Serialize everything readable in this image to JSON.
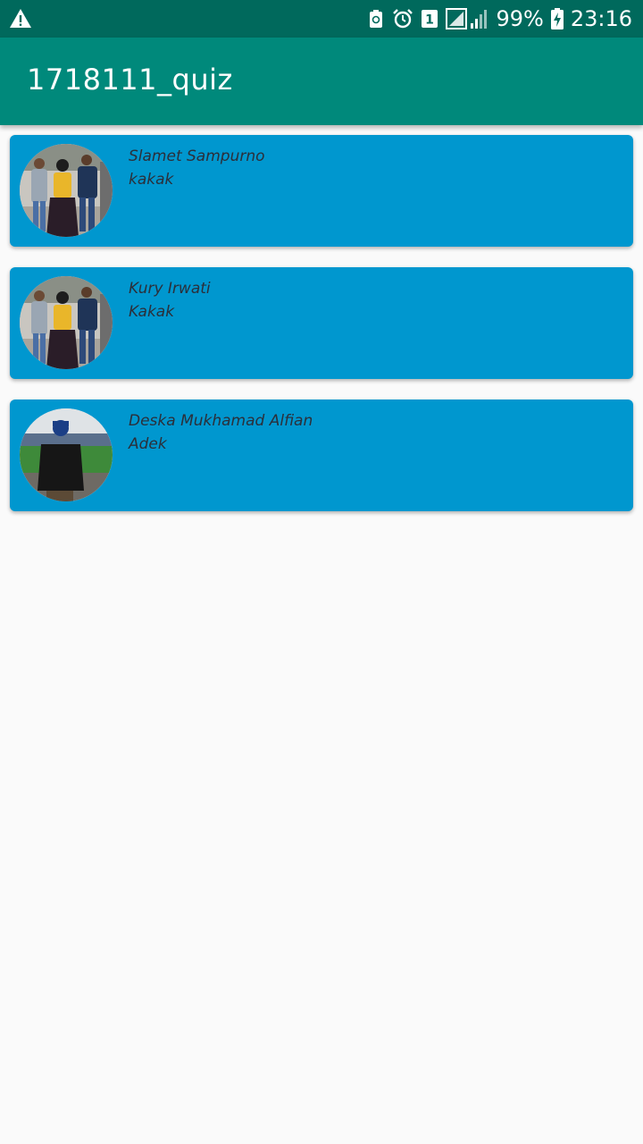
{
  "status_bar": {
    "battery_percent": "99%",
    "time": "23:16",
    "sim_number": "1",
    "icons": [
      "warning-icon",
      "battery-saver-icon",
      "alarm-icon",
      "sim-icon",
      "signal-icon",
      "battery-icon"
    ]
  },
  "app_bar": {
    "title": "1718111_quiz"
  },
  "colors": {
    "status_bar": "#00695c",
    "app_bar": "#00897b",
    "card": "#0097cf",
    "card_text": "#2b2f3a",
    "background": "#fafafa"
  },
  "contacts": [
    {
      "name": "Slamet Sampurno",
      "relation": "kakak",
      "photo": "family-photo"
    },
    {
      "name": "Kury Irwati",
      "relation": "Kakak",
      "photo": "family-photo"
    },
    {
      "name": "Deska Mukhamad Alfian",
      "relation": "Adek",
      "photo": "stadium-photo"
    }
  ]
}
